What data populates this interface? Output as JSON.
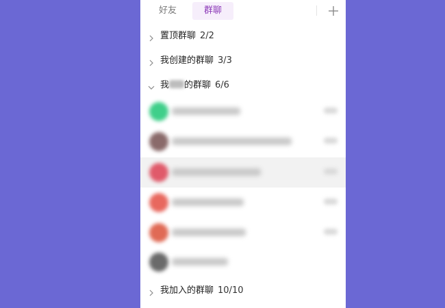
{
  "tabs": [
    {
      "label": "好友",
      "active": false
    },
    {
      "label": "群聊",
      "active": true
    }
  ],
  "colors": {
    "background": "#6b68d4",
    "active_tab_text": "#8d3bb8",
    "active_tab_bg": "#f6eefb"
  },
  "sections": [
    {
      "label": "置顶群聊",
      "count": "2/2",
      "expanded": false
    },
    {
      "label": "我创建的群聊",
      "count": "3/3",
      "expanded": false
    },
    {
      "label_prefix": "我",
      "label_suffix": "的群聊",
      "count": "6/6",
      "expanded": true
    },
    {
      "label": "我加入的群聊",
      "count": "10/10",
      "expanded": false
    }
  ],
  "groups": [
    {
      "avatar_color": "#3fcf8a"
    },
    {
      "avatar_color": "#8a6a6a"
    },
    {
      "avatar_color": "#e05a6a"
    },
    {
      "avatar_color": "#e8685e"
    },
    {
      "avatar_color": "#e06a55"
    },
    {
      "avatar_color": "#6a6a6a"
    }
  ],
  "icons": {
    "add": "plus-icon",
    "collapsed": "chevron-right-icon",
    "expanded": "chevron-down-icon"
  }
}
